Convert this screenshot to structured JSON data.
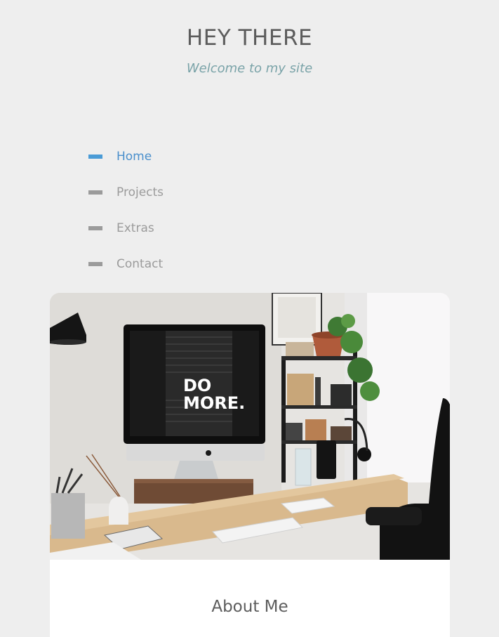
{
  "header": {
    "title": "HEY THERE",
    "tagline": "Welcome to my site"
  },
  "nav": {
    "items": [
      {
        "label": "Home",
        "active": true
      },
      {
        "label": "Projects",
        "active": false
      },
      {
        "label": "Extras",
        "active": false
      },
      {
        "label": "Contact",
        "active": false
      }
    ]
  },
  "hero": {
    "monitor_text_line1": "DO",
    "monitor_text_line2": "MORE."
  },
  "about": {
    "title": "About Me"
  },
  "colors": {
    "background": "#eeeeee",
    "accent": "#4a9bd6",
    "nav_inactive": "#9b9b9b",
    "tagline": "#7aa3a8",
    "title": "#5c5c5c"
  }
}
